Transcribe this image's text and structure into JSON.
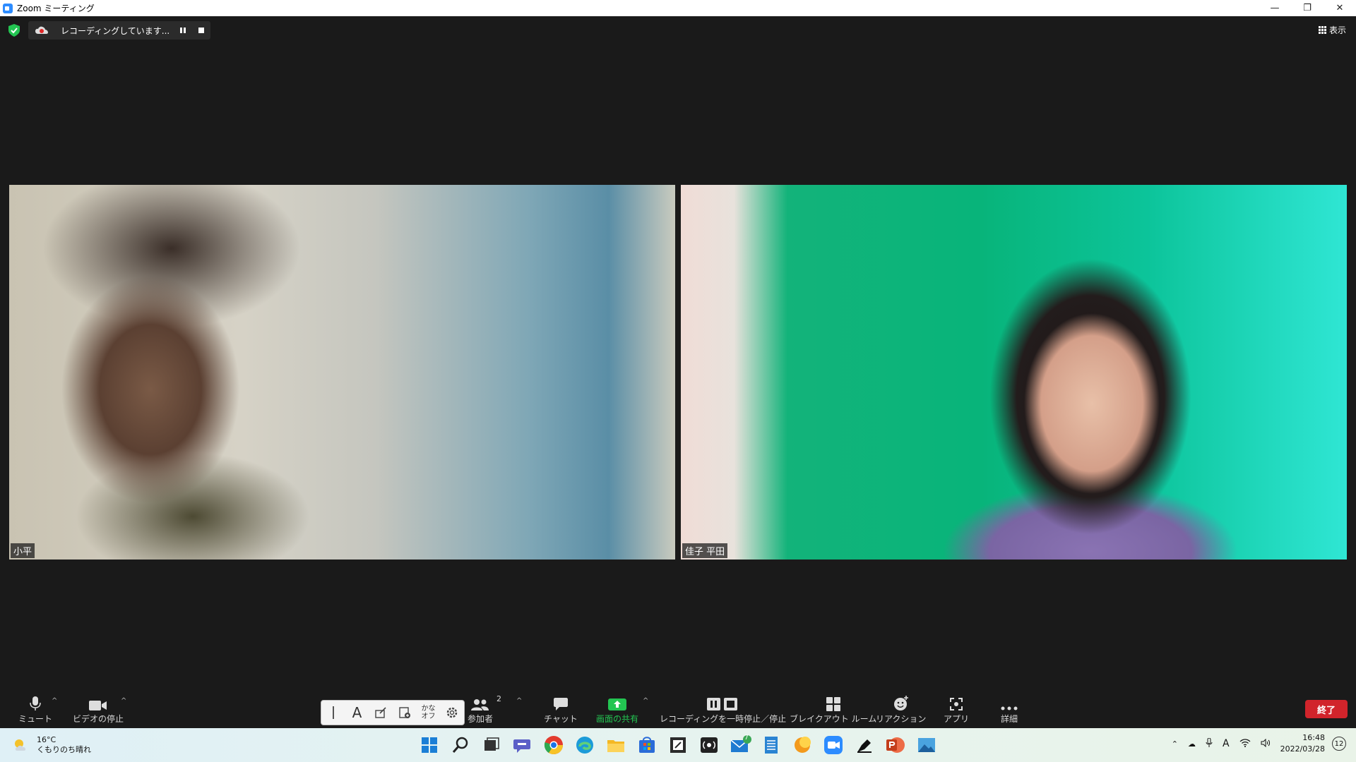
{
  "window": {
    "title": "Zoom ミーティング",
    "controls": [
      "—",
      "❐",
      "✕"
    ]
  },
  "recording": {
    "status_text": "レコーディングしています...",
    "pause_icon": "pause-icon",
    "stop_icon": "stop-icon"
  },
  "view_button": {
    "label": "表示"
  },
  "participants": [
    {
      "name": "小平"
    },
    {
      "name": "佳子 平田"
    }
  ],
  "toolbar": {
    "mute": "ミュート",
    "stop_video": "ビデオの停止",
    "participants": "参加者",
    "participants_count": "2",
    "chat": "チャット",
    "share_screen": "画面の共有",
    "pause_stop_recording": "レコーディングを一時停止／停止",
    "breakout_rooms": "ブレイクアウト ルーム",
    "reactions": "リアクション",
    "apps": "アプリ",
    "more": "詳細",
    "end": "終了",
    "share_color": "#23c552",
    "end_color": "#d1242b"
  },
  "ime_bar": {
    "kana_top": "かな",
    "kana_bottom": "オフ"
  },
  "taskbar": {
    "weather_temp": "16°C",
    "weather_desc": "くもりのち晴れ",
    "mail_badge": "7",
    "time": "16:48",
    "date": "2022/03/28",
    "notifications": "12",
    "ime_mode": "A"
  }
}
